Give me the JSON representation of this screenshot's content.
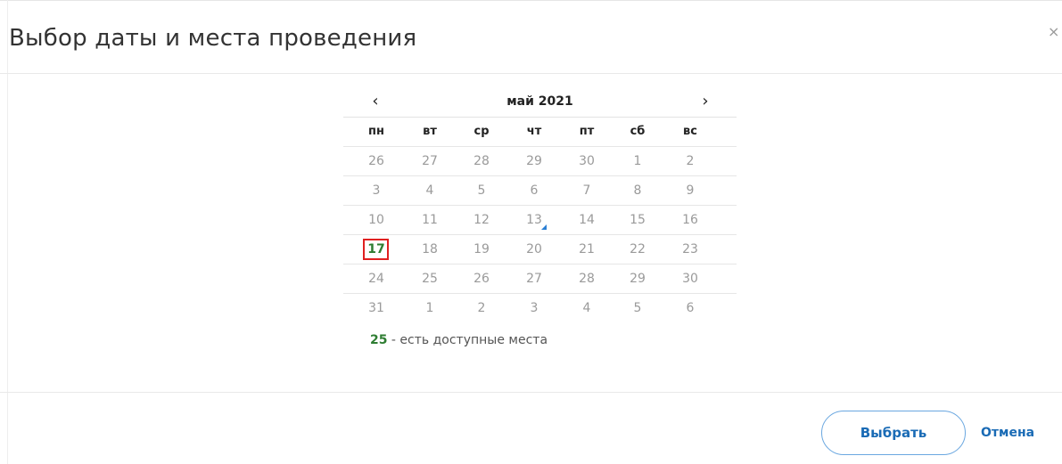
{
  "dialog": {
    "title": "Выбор даты и места проведения",
    "close": "×"
  },
  "calendar": {
    "prev": "‹",
    "next": "›",
    "month_label": "май 2021",
    "weekdays": [
      "пн",
      "вт",
      "ср",
      "чт",
      "пт",
      "сб",
      "вс"
    ],
    "weeks": [
      [
        "26",
        "27",
        "28",
        "29",
        "30",
        "1",
        "2"
      ],
      [
        "3",
        "4",
        "5",
        "6",
        "7",
        "8",
        "9"
      ],
      [
        "10",
        "11",
        "12",
        "13",
        "14",
        "15",
        "16"
      ],
      [
        "17",
        "18",
        "19",
        "20",
        "21",
        "22",
        "23"
      ],
      [
        "24",
        "25",
        "26",
        "27",
        "28",
        "29",
        "30"
      ],
      [
        "31",
        "1",
        "2",
        "3",
        "4",
        "5",
        "6"
      ]
    ],
    "selected_day": "17",
    "available_days": [
      "17"
    ],
    "marked_day": "13"
  },
  "legend": {
    "number": "25",
    "text": " - есть доступные места"
  },
  "buttons": {
    "select": "Выбрать",
    "cancel": "Отмена"
  },
  "colors": {
    "available": "#2e7d32",
    "selected_border": "#e02020",
    "accent": "#1a6bb5",
    "marker": "#2a7fd4"
  }
}
